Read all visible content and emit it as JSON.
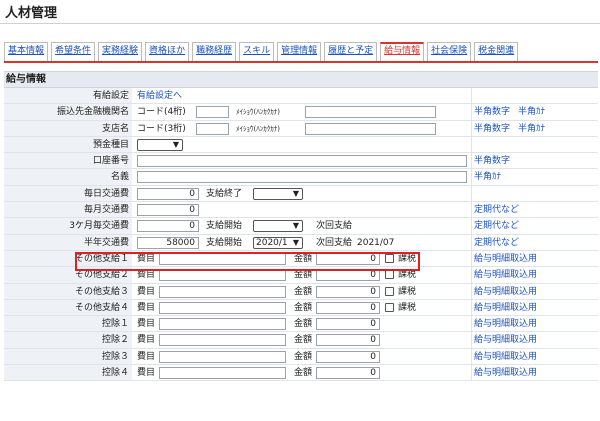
{
  "page": {
    "title": "人材管理"
  },
  "tabs": [
    {
      "label": "基本情報",
      "active": false
    },
    {
      "label": "希望条件",
      "active": false
    },
    {
      "label": "実務経験",
      "active": false
    },
    {
      "label": "資格ほか",
      "active": false
    },
    {
      "label": "職務経歴",
      "active": false
    },
    {
      "label": "スキル",
      "active": false
    },
    {
      "label": "管理情報",
      "active": false
    },
    {
      "label": "履歴と予定",
      "active": false
    },
    {
      "label": "給与情報",
      "active": true
    },
    {
      "label": "社会保険",
      "active": false
    },
    {
      "label": "税金関連",
      "active": false
    }
  ],
  "section": {
    "title": "給与情報"
  },
  "rows": {
    "yukyu": {
      "label": "有給設定",
      "link": "有給設定へ"
    },
    "bank": {
      "label": "振込先金融機関名",
      "code": "コード(4桁)",
      "kana": "ﾒｲｼｮｳ(ﾊﾝｶｸｶﾅ)",
      "note1": "半角数字",
      "note2": "半角ｶﾅ"
    },
    "branch": {
      "label": "支店名",
      "code": "コード(3桁)",
      "kana": "ﾒｲｼｮｳ(ﾊﾝｶｸｶﾅ)",
      "note1": "半角数字",
      "note2": "半角ｶﾅ"
    },
    "account_type": {
      "label": "預金種目",
      "value": ""
    },
    "account_no": {
      "label": "口座番号",
      "note": "半角数字"
    },
    "holder": {
      "label": "名義",
      "note": "半角ｶﾅ"
    },
    "daily": {
      "label": "毎日交通費",
      "value": "0",
      "end_label": "支給終了",
      "end_value": ""
    },
    "monthly": {
      "label": "毎月交通費",
      "value": "0",
      "note": "定期代など"
    },
    "three_month": {
      "label": "3ケ月毎交通費",
      "value": "0",
      "start_label": "支給開始",
      "start_value": "",
      "next_label": "次回支給",
      "note": "定期代など"
    },
    "half_year": {
      "label": "半年交通費",
      "value": "58000",
      "start_label": "支給開始",
      "start_value": "2020/1",
      "next_label": "次回支給",
      "next_value": "2021/07",
      "note": "定期代など"
    }
  },
  "other_pay": [
    {
      "label": "その他支給１",
      "item": "費目",
      "amount_label": "金額",
      "amount": "0",
      "tax": "課税",
      "note": "給与明細取込用"
    },
    {
      "label": "その他支給２",
      "item": "費目",
      "amount_label": "金額",
      "amount": "0",
      "tax": "課税",
      "note": "給与明細取込用"
    },
    {
      "label": "その他支給３",
      "item": "費目",
      "amount_label": "金額",
      "amount": "0",
      "tax": "課税",
      "note": "給与明細取込用"
    },
    {
      "label": "その他支給４",
      "item": "費目",
      "amount_label": "金額",
      "amount": "0",
      "tax": "課税",
      "note": "給与明細取込用"
    }
  ],
  "deductions": [
    {
      "label": "控除１",
      "item": "費目",
      "amount_label": "金額",
      "amount": "0",
      "note": "給与明細取込用"
    },
    {
      "label": "控除２",
      "item": "費目",
      "amount_label": "金額",
      "amount": "0",
      "note": "給与明細取込用"
    },
    {
      "label": "控除３",
      "item": "費目",
      "amount_label": "金額",
      "amount": "0",
      "note": "給与明細取込用"
    },
    {
      "label": "控除４",
      "item": "費目",
      "amount_label": "金額",
      "amount": "0",
      "note": "給与明細取込用"
    }
  ],
  "colors": {
    "accent": "#d9342c",
    "link": "#1b52c4",
    "highlight": "#e02020",
    "label_bg": "#eef1f5"
  },
  "icons": {
    "select_arrow": "chevron-down-icon"
  }
}
